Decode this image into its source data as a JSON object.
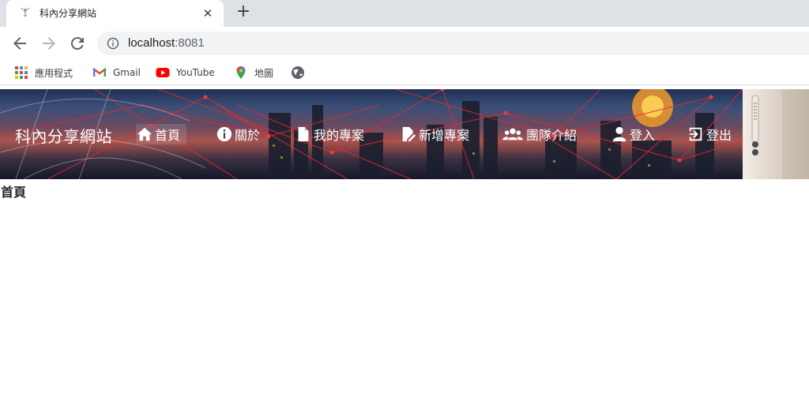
{
  "browser": {
    "tab_title": "科內分享網站",
    "url_host": "localhost",
    "url_port": ":8081",
    "bookmarks": [
      {
        "label": "應用程式",
        "icon": "apps-grid-icon"
      },
      {
        "label": "Gmail",
        "icon": "gmail-icon"
      },
      {
        "label": "YouTube",
        "icon": "youtube-icon"
      },
      {
        "label": "地圖",
        "icon": "maps-pin-icon"
      },
      {
        "label": "",
        "icon": "globe-icon"
      }
    ]
  },
  "navbar": {
    "brand": "科內分享網站",
    "items": [
      {
        "label": "首頁",
        "icon": "home-icon"
      },
      {
        "label": "關於",
        "icon": "info-icon"
      },
      {
        "label": "我的專案",
        "icon": "file-icon"
      },
      {
        "label": "新增專案",
        "icon": "file-edit-icon"
      },
      {
        "label": "團隊介紹",
        "icon": "users-icon"
      },
      {
        "label": "登入",
        "icon": "user-icon"
      },
      {
        "label": "登出",
        "icon": "logout-icon"
      }
    ]
  },
  "main": {
    "heading": "首頁"
  },
  "colors": {
    "tabstrip": "#dee1e6",
    "omnibox": "#f1f3f4",
    "nav_text": "#ffffff"
  }
}
